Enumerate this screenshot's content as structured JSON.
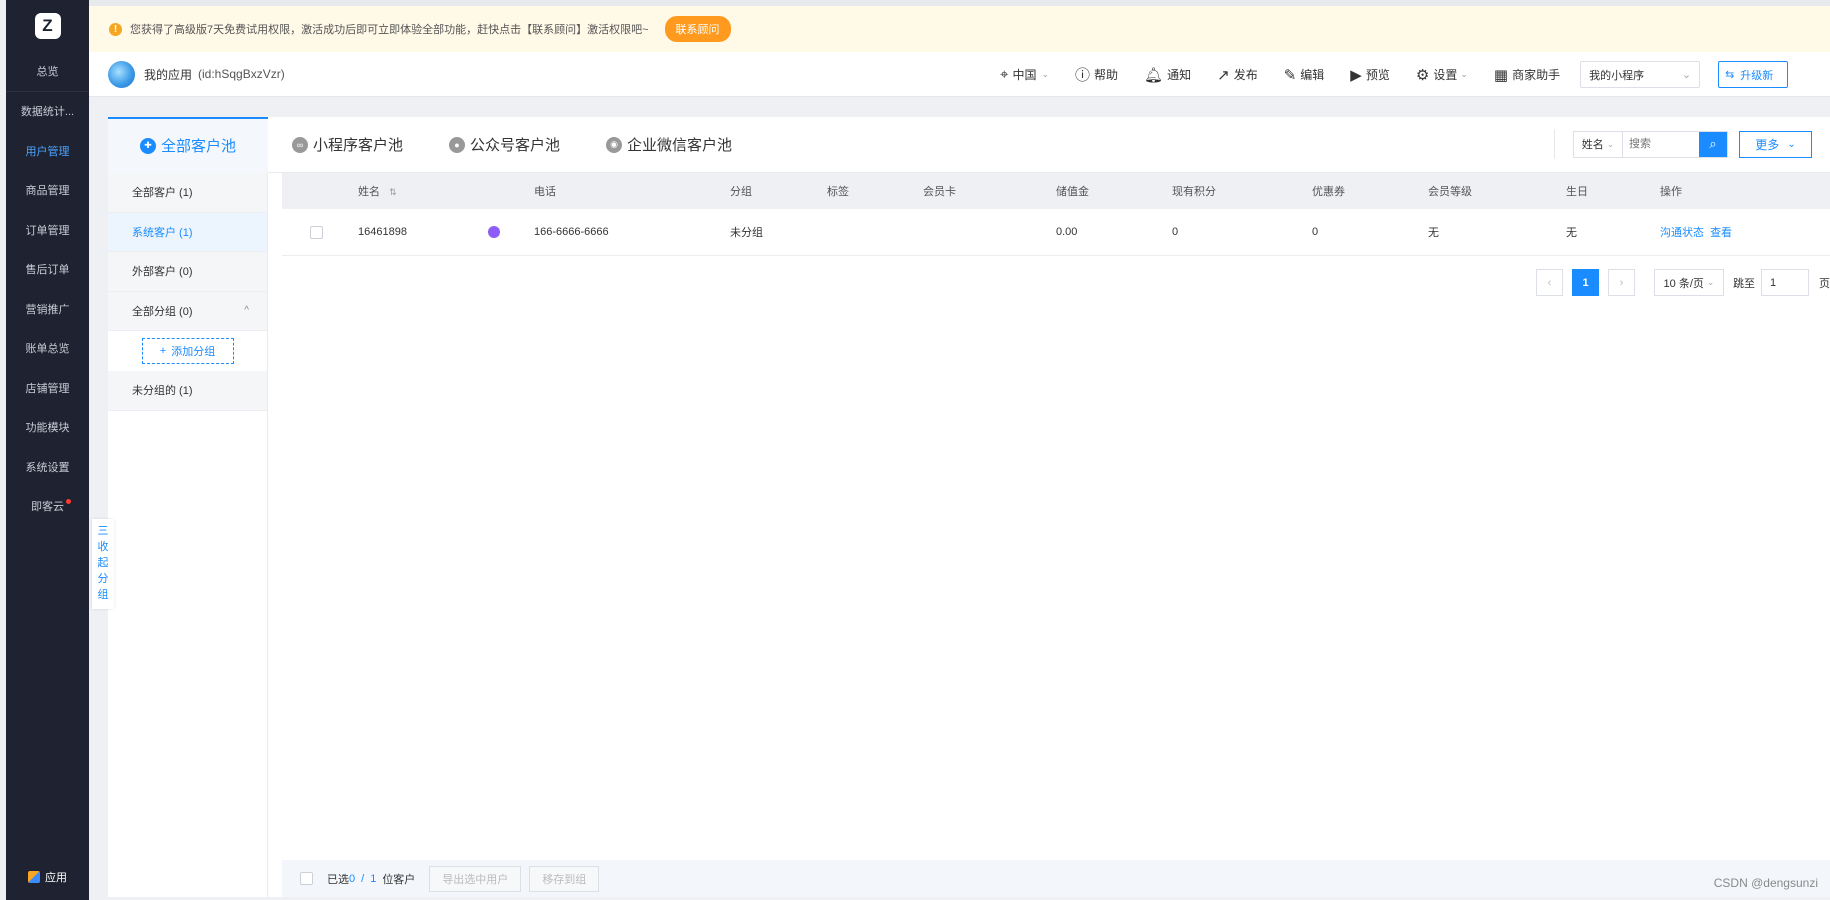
{
  "sidebar": {
    "logo": "Z",
    "items": [
      {
        "label": "总览",
        "name": "overview"
      },
      {
        "label": "数据统计...",
        "name": "data-stats"
      },
      {
        "label": "用户管理",
        "name": "user-management",
        "active": true
      },
      {
        "label": "商品管理",
        "name": "product-management"
      },
      {
        "label": "订单管理",
        "name": "order-management"
      },
      {
        "label": "售后订单",
        "name": "after-sales-orders"
      },
      {
        "label": "营销推广",
        "name": "marketing"
      },
      {
        "label": "账单总览",
        "name": "billing-overview"
      },
      {
        "label": "店铺管理",
        "name": "store-management"
      },
      {
        "label": "功能模块",
        "name": "function-modules"
      },
      {
        "label": "系统设置",
        "name": "system-settings"
      },
      {
        "label": "即客云",
        "name": "jikeyun",
        "dot": true
      }
    ],
    "apps_label": "应用"
  },
  "banner": {
    "text": "您获得了高级版7天免费试用权限，激活成功后即可立即体验全部功能，赶快点击【联系顾问】激活权限吧~",
    "button": "联系顾问"
  },
  "header": {
    "app_name": "我的应用",
    "app_id": "(id:hSqgBxzVzr)",
    "region": "中国",
    "help": "帮助",
    "notify": "通知",
    "publish": "发布",
    "edit": "编辑",
    "preview": "预览",
    "settings": "设置",
    "assistant": "商家助手",
    "mini_program_select": "我的小程序",
    "upgrade": "升级新"
  },
  "tabs": [
    {
      "label": "全部客户池",
      "active": true
    },
    {
      "label": "小程序客户池"
    },
    {
      "label": "公众号客户池"
    },
    {
      "label": "企业微信客户池"
    }
  ],
  "search": {
    "field": "姓名",
    "placeholder": "搜索",
    "more": "更多"
  },
  "groups": {
    "all_customers": "全部客户 (1)",
    "system_customers": "系统客户 (1)",
    "external_customers": "外部客户 (0)",
    "all_groups": "全部分组 (0)",
    "add_group": "添加分组",
    "ungrouped": "未分组的 (1)",
    "collapse": [
      "三",
      "收",
      "起",
      "分",
      "组"
    ]
  },
  "table": {
    "headers": {
      "name": "姓名",
      "phone": "电话",
      "group": "分组",
      "tag": "标签",
      "member_card": "会员卡",
      "balance": "储值金",
      "points": "现有积分",
      "coupon": "优惠券",
      "level": "会员等级",
      "birthday": "生日",
      "actions": "操作"
    },
    "rows": [
      {
        "name": "16461898",
        "phone": "166-6666-6666",
        "group": "未分组",
        "tag": "",
        "member_card": "",
        "balance": "0.00",
        "points": "0",
        "coupon": "0",
        "level": "无",
        "birthday": "无",
        "action_status": "沟通状态",
        "action_view": "查看"
      }
    ]
  },
  "pagination": {
    "prev": "‹",
    "current": "1",
    "next": "›",
    "page_size": "10 条/页",
    "jump_label": "跳至",
    "jump_value": "1",
    "page_suffix": "页"
  },
  "footer": {
    "selected_prefix": "已选",
    "selected": "0",
    "slash": "/",
    "total": "1",
    "suffix": "位客户",
    "export": "导出选中用户",
    "move": "移存到组"
  },
  "watermark": "CSDN @dengsunzi"
}
